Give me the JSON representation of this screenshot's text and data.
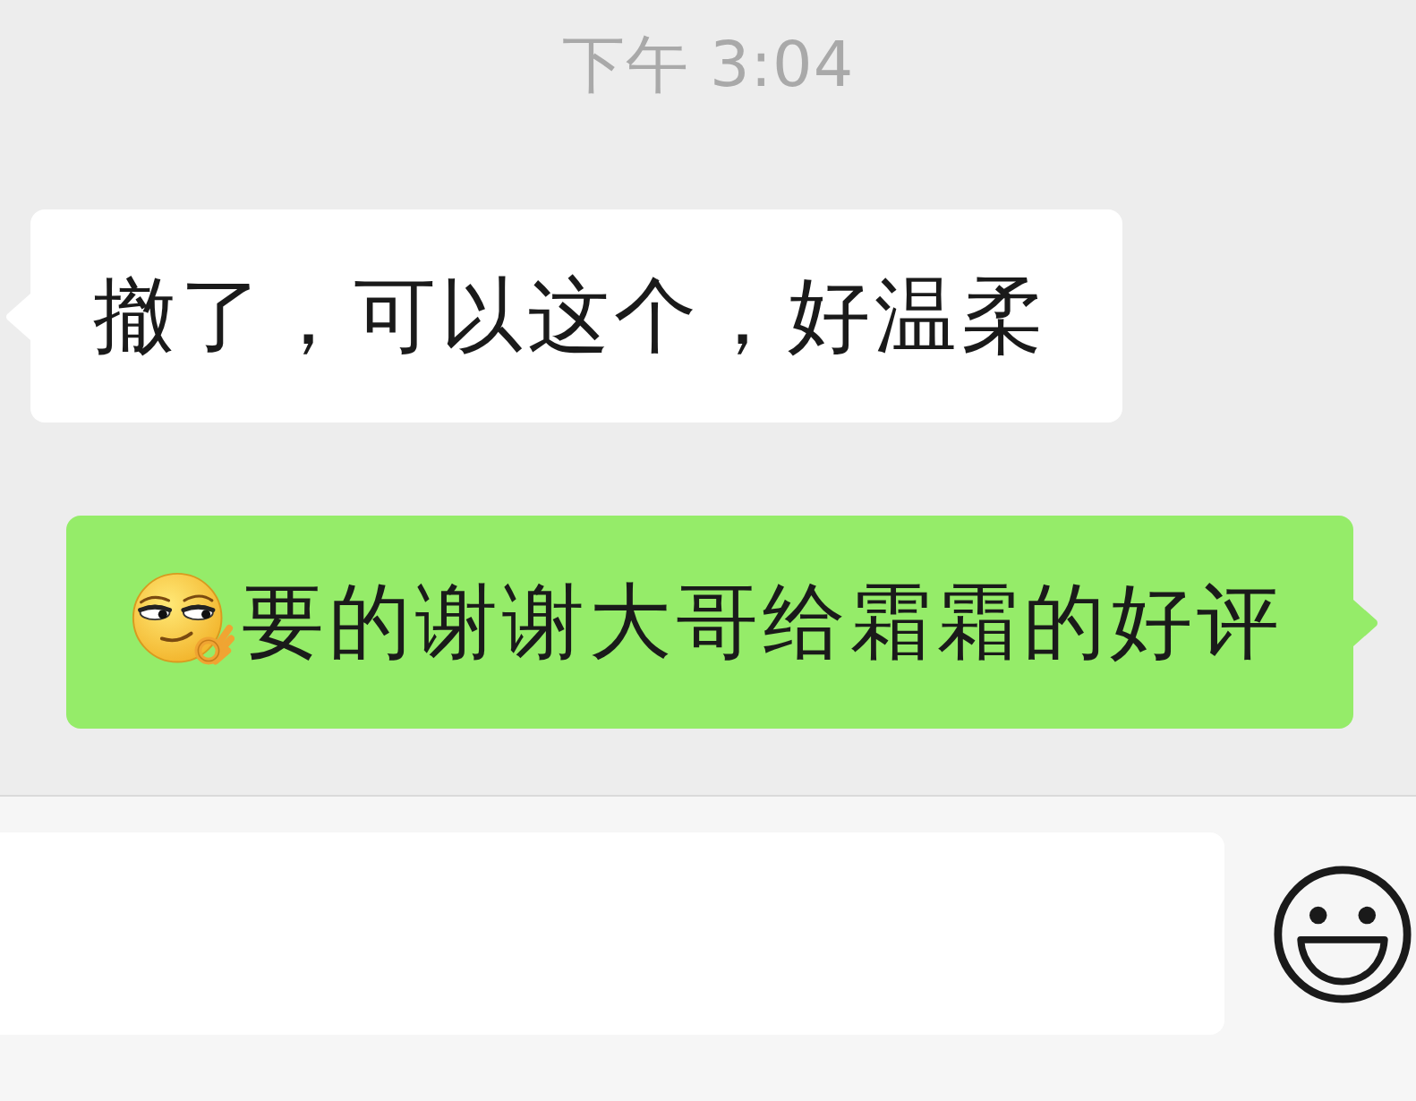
{
  "timestamp": "下午 3:04",
  "messages": [
    {
      "kind": "incoming",
      "emoji": false,
      "text": "撤了，可以这个，好温柔"
    },
    {
      "kind": "outgoing",
      "emoji": true,
      "text": "要的谢谢大哥给霜霜的好评"
    }
  ]
}
